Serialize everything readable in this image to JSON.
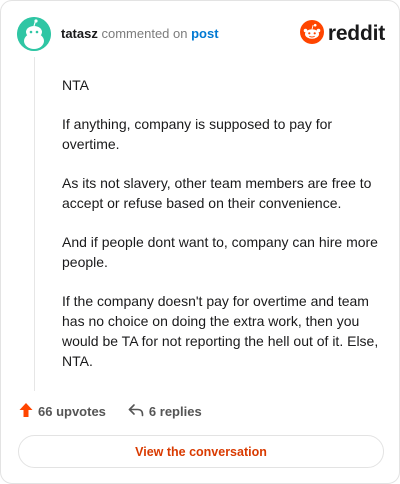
{
  "comment": {
    "author": "tatasz",
    "verb": "commented on",
    "post_link": "post",
    "paragraphs": [
      "NTA",
      "If anything, company is supposed to pay for overtime.",
      "As its not slavery, other team members are free to accept or refuse based on their convenience.",
      "And if people dont want to, company can hire more people.",
      "If the company doesn't pay for overtime and team has no choice on doing the extra work, then you would be TA for not reporting the hell out of it. Else, NTA."
    ]
  },
  "brand": {
    "name": "reddit",
    "icon": "reddit-snoo-icon",
    "color": "#ff4500"
  },
  "avatar": {
    "icon": "snoo-avatar-icon",
    "color": "#2fc6a4"
  },
  "actions": {
    "upvotes": "66 upvotes",
    "replies": "6 replies",
    "upvote_icon": "upvote-arrow-icon",
    "reply_icon": "reply-arrow-icon",
    "accent": "#ff4500"
  },
  "cta": {
    "label": "View the conversation",
    "color": "#d93a00"
  }
}
